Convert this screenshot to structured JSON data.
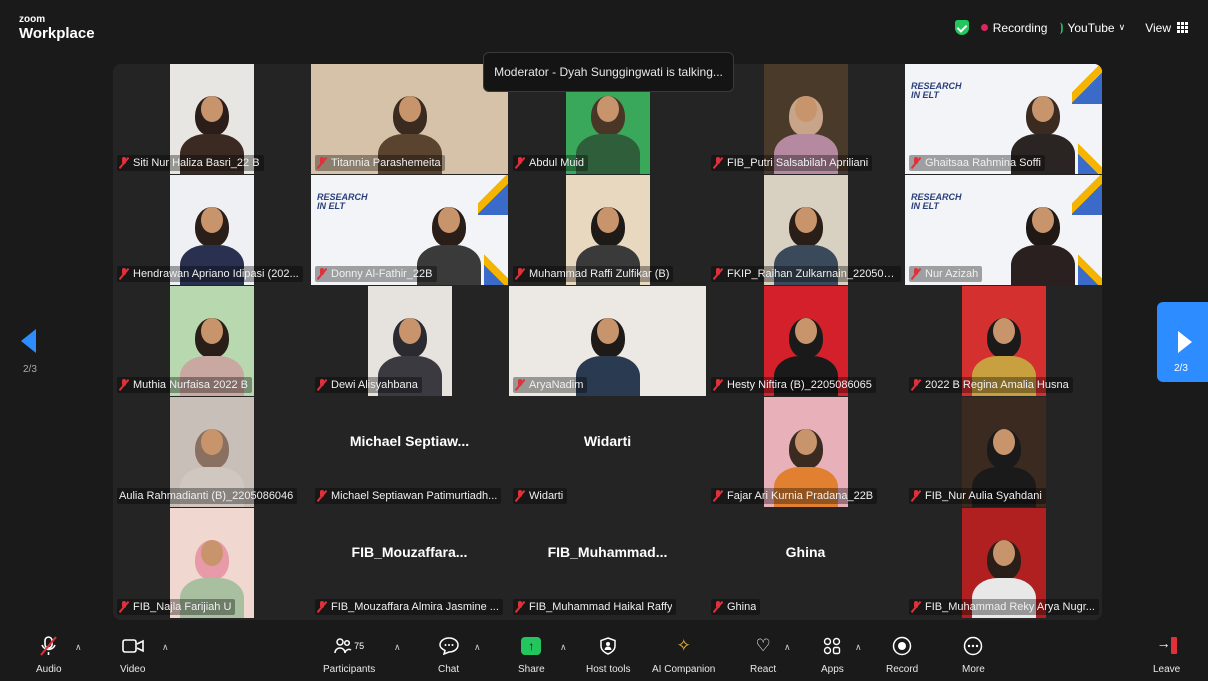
{
  "app": {
    "brand_small": "zoom",
    "brand_big": "Workplace"
  },
  "topbar": {
    "recording": "Recording",
    "youtube": "YouTube",
    "view": "View"
  },
  "toast": "Moderator - Dyah Sunggingwati is talking...",
  "nav": {
    "left_page": "2/3",
    "right_page": "2/3"
  },
  "slide_text": "RESEARCH\nIN ELT",
  "tiles": [
    {
      "name": "Siti Nur Haliza Basri_22 B",
      "video": true
    },
    {
      "name": "Titannia Parashemeita",
      "video": true
    },
    {
      "name": "Abdul Muid",
      "video": true
    },
    {
      "name": "FIB_Putri Salsabilah Apriliani",
      "video": true
    },
    {
      "name": "Ghaitsaa Rahmina Soffi",
      "video": true
    },
    {
      "name": "Hendrawan Apriano Idipasi (202...",
      "video": true
    },
    {
      "name": "Donny Al-Fathir_22B",
      "video": true
    },
    {
      "name": "Muhammad Raffi Zulfikar (B)",
      "video": true
    },
    {
      "name": "FKIP_Raihan Zulkarnain_2205086...",
      "video": true
    },
    {
      "name": "Nur Azizah",
      "video": true
    },
    {
      "name": "Muthia Nurfaisa 2022 B",
      "video": true
    },
    {
      "name": "Dewi Alisyahbana",
      "video": true
    },
    {
      "name": "AryaNadim",
      "video": true
    },
    {
      "name": "Hesty Niftira (B)_2205086065",
      "video": true
    },
    {
      "name": "2022 B Regina Amalia Husna",
      "video": true
    },
    {
      "name": "Aulia Rahmadianti (B)_2205086046",
      "video": true
    },
    {
      "name": "Michael Septiawan Patimurtiadh...",
      "big": "Michael  Septiaw..."
    },
    {
      "name": "Widarti",
      "big": "Widarti"
    },
    {
      "name": "Fajar Ari Kurnia Pradana_22B",
      "video": true
    },
    {
      "name": "FIB_Nur Aulia Syahdani",
      "video": true
    },
    {
      "name": "FIB_Najla Farijiah U",
      "video": true
    },
    {
      "name": "FIB_Mouzaffara Almira Jasmine ...",
      "big": "FIB_Mouzaffara..."
    },
    {
      "name": "FIB_Muhammad Haikal Raffy",
      "big": "FIB_Muhammad..."
    },
    {
      "name": "Ghina",
      "big": "Ghina"
    },
    {
      "name": "FIB_Muhammad Reky Arya Nugr...",
      "video": true
    }
  ],
  "toolbar": {
    "audio": "Audio",
    "video": "Video",
    "participants": "Participants",
    "participants_count": "75",
    "chat": "Chat",
    "share": "Share",
    "host_tools": "Host tools",
    "ai_companion": "AI Companion",
    "react": "React",
    "apps": "Apps",
    "record": "Record",
    "more": "More",
    "leave": "Leave"
  }
}
